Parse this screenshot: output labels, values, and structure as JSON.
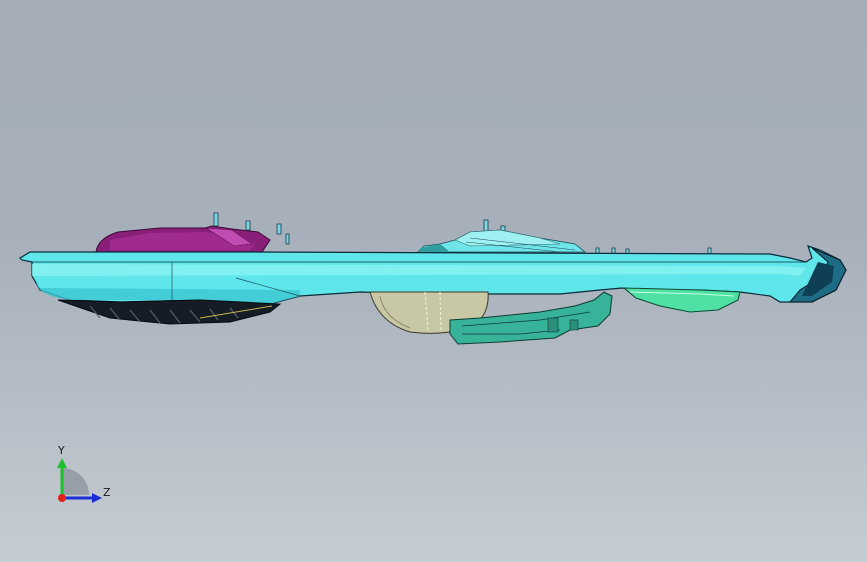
{
  "viewport": {
    "background_top": "#a3acb7",
    "background_bottom": "#c6ccd3"
  },
  "model": {
    "body_color": "#5ee6ea",
    "body_dark": "#2bb3c0",
    "cover_color": "#8a1f7a",
    "cover_light": "#b43ea6",
    "pod_color": "#c9c8a5",
    "teal_color": "#37b39a",
    "green_color": "#4fe0a4",
    "edge_color": "#0b2a3a"
  },
  "triad": {
    "y_label": "Y",
    "z_label": "Z",
    "y_color": "#1dbf2c",
    "z_color": "#1b2fd6",
    "x_color": "#e0211c"
  }
}
